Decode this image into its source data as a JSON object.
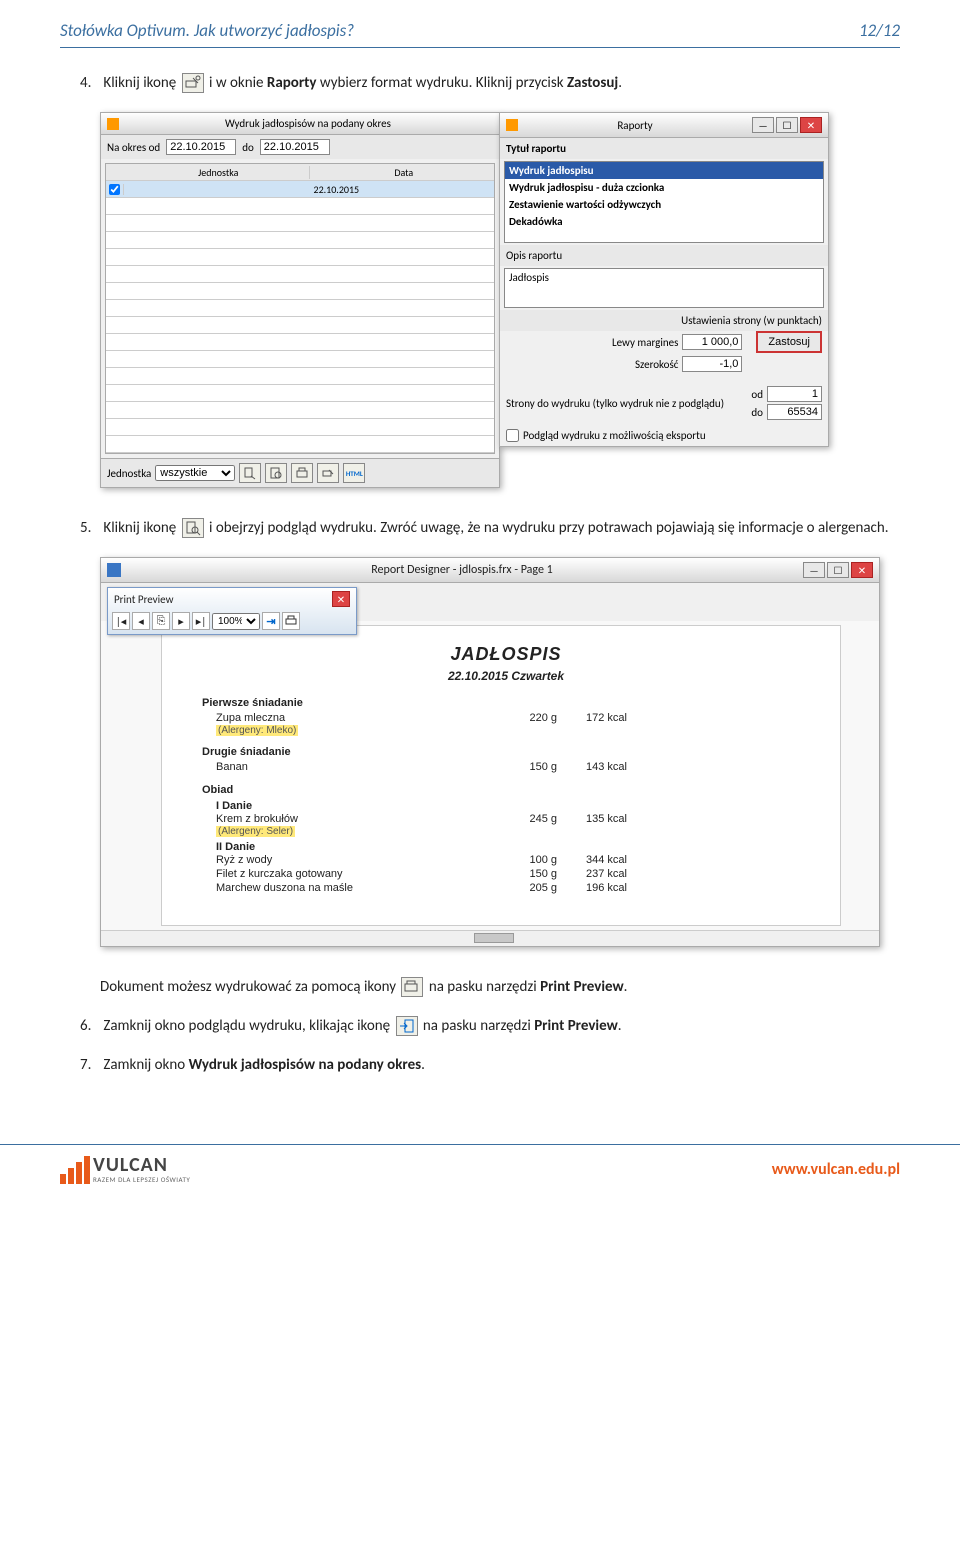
{
  "header": {
    "title": "Stołówka Optivum. Jak utworzyć jadłospis?",
    "page": "12/12"
  },
  "steps": {
    "s4_pre": "Kliknij ikonę ",
    "s4_mid": " i w oknie ",
    "s4_win": "Raporty",
    "s4_post": " wybierz format wydruku. Kliknij przycisk ",
    "s4_btn": "Zastosuj",
    "s5_pre": "Kliknij ikonę ",
    "s5_post": " i obejrzyj podgląd wydruku. Zwróć uwagę, że na wydruku przy potrawach pojawiają się informacje o alergenach.",
    "doc_pre": "Dokument możesz wydrukować za pomocą ikony ",
    "doc_post": " na pasku narzędzi ",
    "doc_win": "Print Preview",
    "s6_pre": "Zamknij okno podglądu wydruku, klikając ikonę ",
    "s6_post": " na pasku narzędzi ",
    "s6_win": "Print Preview",
    "s7": "Zamknij okno ",
    "s7_win": "Wydruk jadłospisów na podany okres"
  },
  "win_left": {
    "title": "Wydruk jadłospisów na podany okres",
    "date_lbl1": "Na okres od",
    "date1": "22.10.2015",
    "date_lbl2": "do",
    "date2": "22.10.2015",
    "col1": "Jednostka",
    "col2": "Data",
    "row1_date": "22.10.2015",
    "unit_lbl": "Jednostka",
    "unit_val": "wszystkie",
    "html_btn": "HTML"
  },
  "win_right": {
    "title": "Raporty",
    "section1": "Tytuł raportu",
    "items": [
      "Wydruk jadłospisu",
      "Wydruk jadłospisu - duża czcionka",
      "Zestawienie wartości odżywczych",
      "Dekadówka"
    ],
    "opis_lbl": "Opis raportu",
    "opis_val": "Jadłospis",
    "ust_head": "Ustawienia strony (w punktach)",
    "lewy_lbl": "Lewy margines",
    "lewy_val": "1 000,0",
    "szer_lbl": "Szerokość",
    "szer_val": "-1,0",
    "zastosuj": "Zastosuj",
    "strony_lbl": "Strony do wydruku (tylko wydruk nie z podglądu)",
    "od_lbl": "od",
    "od_val": "1",
    "do_lbl": "do",
    "do_val": "65534",
    "export_chk": "Podgląd wydruku z możliwością eksportu"
  },
  "preview": {
    "designer_title": "Report Designer - jdlospis.frx - Page 1",
    "float_title": "Print Preview",
    "zoom": "100%",
    "doc_title": "JADŁOSPIS",
    "date_line": "22.10.2015   Czwartek",
    "meals": {
      "m1": "Pierwsze śniadanie",
      "m1_d1": "Zupa mleczna",
      "m1_d1_w": "220 g",
      "m1_d1_k": "172 kcal",
      "m1_a": "(Alergeny: Mleko)",
      "m2": "Drugie śniadanie",
      "m2_d1": "Banan",
      "m2_d1_w": "150 g",
      "m2_d1_k": "143 kcal",
      "m3": "Obiad",
      "c1": "I Danie",
      "c1_d1": "Krem z brokułów",
      "c1_d1_w": "245 g",
      "c1_d1_k": "135 kcal",
      "c1_a": "(Alergeny: Seler)",
      "c2": "II Danie",
      "c2_d1": "Ryż z wody",
      "c2_d1_w": "100 g",
      "c2_d1_k": "344 kcal",
      "c2_d2": "Filet z kurczaka gotowany",
      "c2_d2_w": "150 g",
      "c2_d2_k": "237 kcal",
      "c2_d3": "Marchew duszona na maśle",
      "c2_d3_w": "205 g",
      "c2_d3_k": "196 kcal"
    }
  },
  "footer": {
    "brand": "VULCAN",
    "tagline": "RAZEM DLA LEPSZEJ OŚWIATY",
    "url": "www.vulcan.edu.pl"
  }
}
